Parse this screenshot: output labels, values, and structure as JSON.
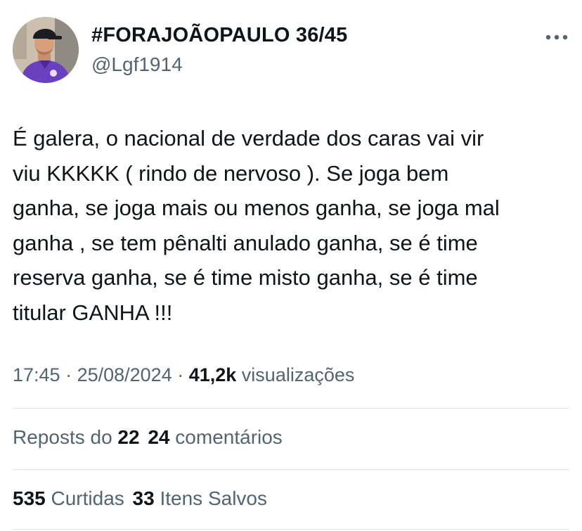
{
  "author": {
    "display_name": "#FORAJOÃOPAULO 36/45",
    "handle": "@Lgf1914"
  },
  "more_icon": "more-horizontal-icon",
  "tweet_text_lines": [
    "É galera, o nacional de verdade dos caras vai vir",
    "viu KKKKK ( rindo de nervoso ). Se joga bem",
    "ganha, se joga mais ou menos ganha, se joga mal",
    "ganha , se tem pênalti anulado ganha, se é time",
    "reserva ganha, se é time misto ganha, se é time",
    "titular GANHA !!!"
  ],
  "meta": {
    "time": "17:45",
    "sep1": " · ",
    "date": "25/08/2024",
    "sep2": " · ",
    "views_count": "41,2k",
    "views_label": " visualizações"
  },
  "stats": {
    "reposts_label": "Reposts do ",
    "reposts_count": "22",
    "comments_count": "24",
    "comments_label": " comentários",
    "likes_count": "535",
    "likes_label": " Curtidas",
    "saves_count": "33",
    "saves_label": " Itens Salvos"
  },
  "colors": {
    "text_primary": "#0f1419",
    "text_secondary": "#536471",
    "divider": "#dfe3e6",
    "avatar_shirt": "#6a3fc0"
  }
}
